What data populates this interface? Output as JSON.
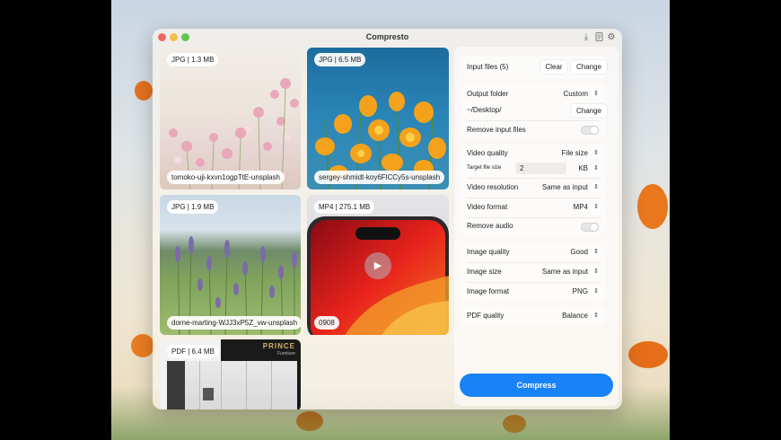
{
  "window": {
    "title": "Compresto"
  },
  "tiles": [
    {
      "tag": "JPG | 1.3 MB",
      "name": "tomoko-uji-kxvn1ogpTtE-unsplash"
    },
    {
      "tag": "JPG | 6.5 MB",
      "name": "sergey-shmidt-koy6FlCCy5s-unsplash"
    },
    {
      "tag": "JPG | 1.9 MB",
      "name": "dorne-marting-WJJ3xP5Z_vw-unsplash"
    },
    {
      "tag": "MP4 | 275.1 MB",
      "name": "0908"
    },
    {
      "tag": "PDF | 6.4 MB",
      "name": "",
      "brand": "PRINCE",
      "brand_sub": "Furniture"
    }
  ],
  "panel": {
    "input_files": {
      "label": "Input files (5)",
      "clear": "Clear",
      "change": "Change"
    },
    "output": {
      "label": "Output folder",
      "value": "Custom",
      "path": "~/Desktop/",
      "change": "Change",
      "remove_label": "Remove input files",
      "remove_on": false
    },
    "video": {
      "quality_label": "Video quality",
      "quality_value": "File size",
      "target_label": "Target file size",
      "target_value": "2",
      "target_unit": "KB",
      "resolution_label": "Video resolution",
      "resolution_value": "Same as input",
      "format_label": "Video format",
      "format_value": "MP4",
      "remove_audio_label": "Remove audio",
      "remove_audio_on": false
    },
    "image": {
      "quality_label": "Image quality",
      "quality_value": "Good",
      "size_label": "Image size",
      "size_value": "Same as input",
      "format_label": "Image format",
      "format_value": "PNG"
    },
    "pdf": {
      "quality_label": "PDF quality",
      "quality_value": "Balance"
    },
    "compress_label": "Compress"
  },
  "icons": {
    "chevron": "⌃⌄",
    "download": "⤓",
    "doc": "📄",
    "gear": "⚙",
    "play": "▶"
  },
  "colors": {
    "accent": "#1a82f7"
  }
}
